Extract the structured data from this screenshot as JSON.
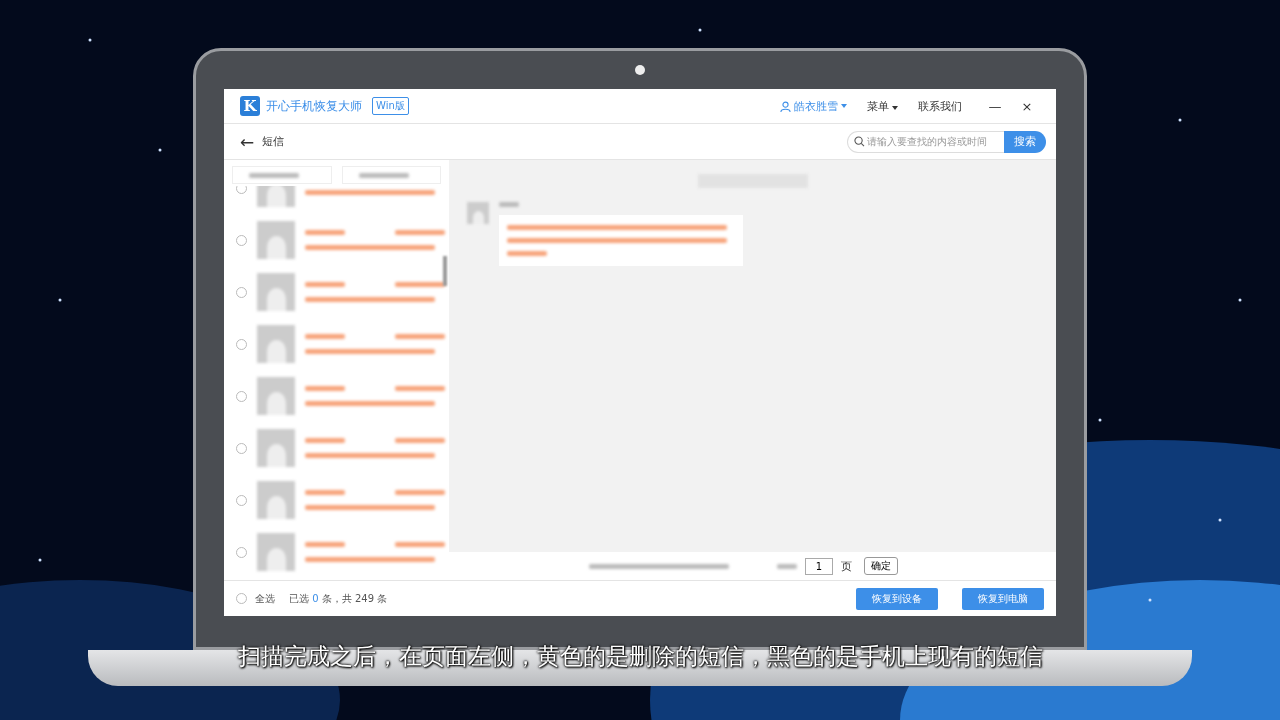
{
  "app": {
    "logo": "K",
    "title": "开心手机恢复大师",
    "edition": "Win版",
    "user": "皓衣胜雪",
    "menu": "菜单",
    "contact": "联系我们",
    "minimize": "—",
    "close": "×"
  },
  "toolbar": {
    "back": "←",
    "title": "短信",
    "search": {
      "placeholder": "请输入要查找的内容或时间"
    },
    "search_button": "搜索"
  },
  "conversations": [
    {
      "selected": false
    },
    {
      "selected": false
    },
    {
      "selected": false
    },
    {
      "selected": false
    },
    {
      "selected": false
    },
    {
      "selected": false
    },
    {
      "selected": false
    },
    {
      "selected": false
    }
  ],
  "pagination": {
    "page_value": "1",
    "page_unit": "页",
    "confirm": "确定"
  },
  "footer": {
    "select_all": "全选",
    "select_all_selected": false,
    "summary_before": "已选",
    "selected_count": "0",
    "summary_after": "条，共 249 条",
    "restore_device": "恢复到设备",
    "restore_pc": "恢复到电脑"
  },
  "subtitle": "扫描完成之后，在页面左侧，黄色的是删除的短信，黑色的是手机上现有的短信"
}
